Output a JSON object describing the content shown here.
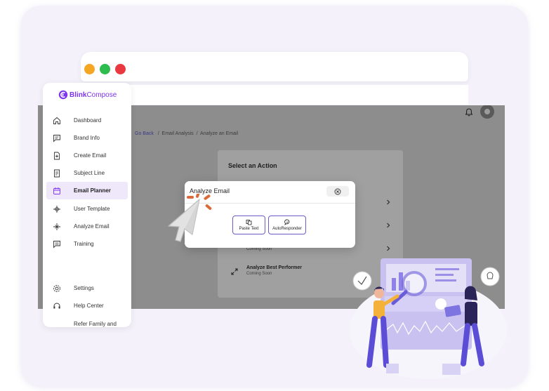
{
  "brand": {
    "name_bold": "Blink",
    "name_rest": "Compose",
    "color": "#7d33f0"
  },
  "window_controls": {
    "colors": [
      "#f5a623",
      "#2dbc4e",
      "#e9383f"
    ]
  },
  "sidebar": {
    "items": [
      {
        "label": "Dashboard",
        "icon": "home-icon"
      },
      {
        "label": "Brand Info",
        "icon": "chat-icon"
      },
      {
        "label": "Create Email",
        "icon": "file-plus-icon"
      },
      {
        "label": "Subject Line",
        "icon": "document-icon"
      },
      {
        "label": "Email Planner",
        "icon": "calendar-icon",
        "active": true
      },
      {
        "label": "User Template",
        "icon": "template-icon"
      },
      {
        "label": "Analyze Email",
        "icon": "analyze-icon"
      },
      {
        "label": "Training",
        "icon": "training-icon"
      }
    ],
    "bottom_items": [
      {
        "label": "Settings",
        "icon": "gear-icon"
      },
      {
        "label": "Help Center",
        "icon": "headset-icon"
      },
      {
        "label": "Refer Family and",
        "icon": "gift-icon"
      }
    ]
  },
  "breadcrumb": {
    "back": "Go Back",
    "sep": "/",
    "items": [
      "Email Analysis",
      "Analyze an Email"
    ]
  },
  "action_panel": {
    "title": "Select an Action",
    "partial_status": "Coming Soon",
    "last_item": {
      "name": "Analyze Best Performer",
      "status": "Coming Soon"
    }
  },
  "modal": {
    "title": "Analyze Email",
    "buttons": [
      {
        "label": "Paste Text",
        "icon": "paste-icon"
      },
      {
        "label": "AutoResponder",
        "icon": "chat-bubble-icon"
      }
    ]
  }
}
